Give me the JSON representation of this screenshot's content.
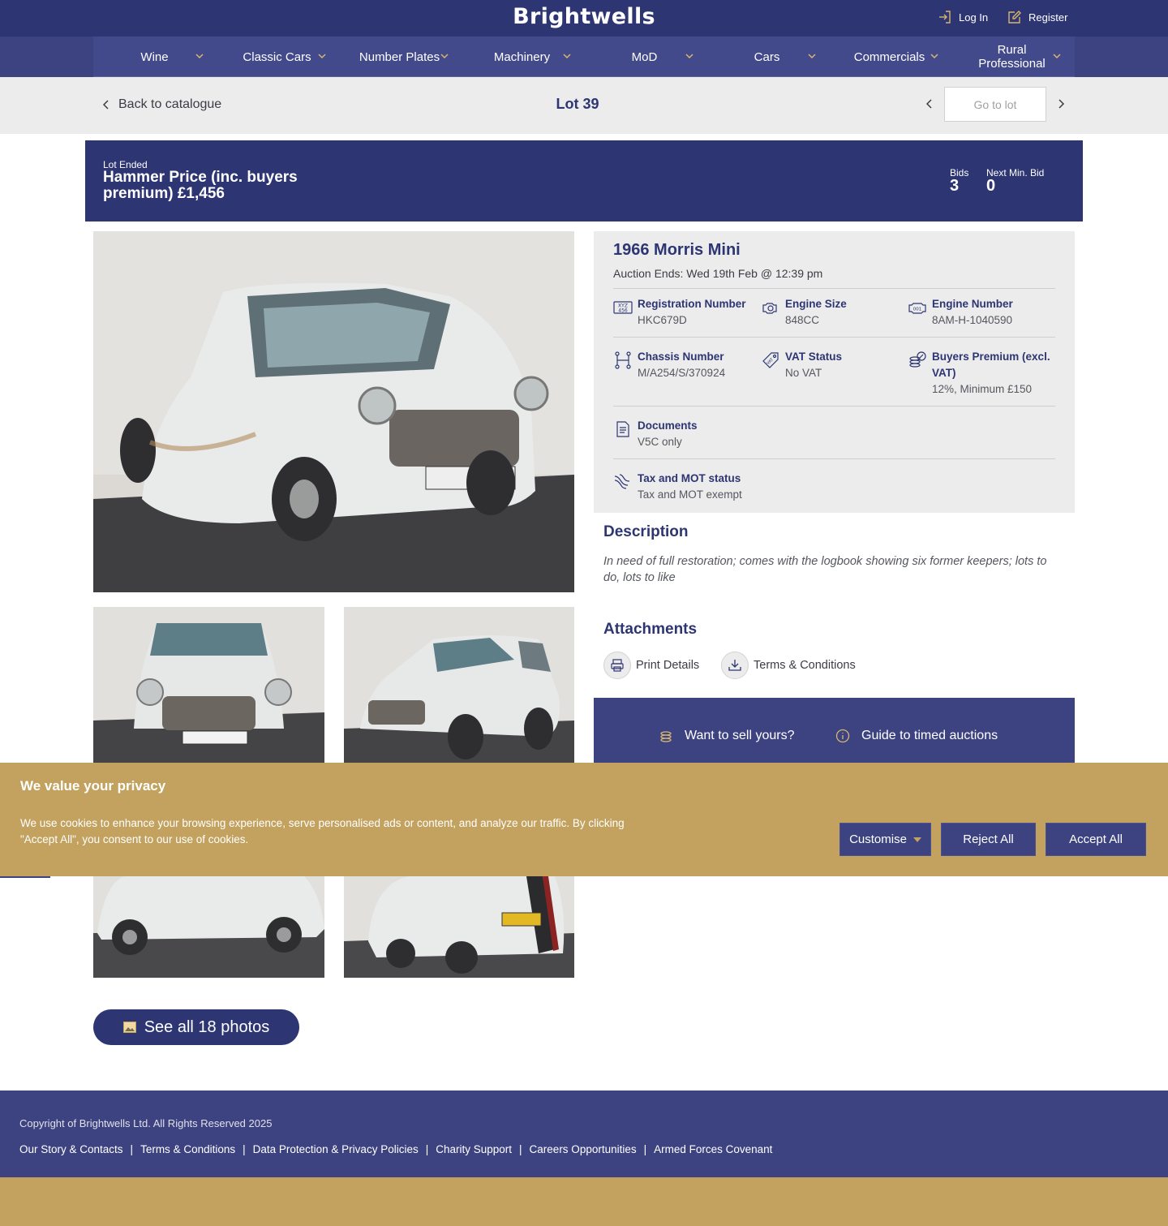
{
  "header": {
    "logo": "Brightwells",
    "login_label": "Log In",
    "register_label": "Register"
  },
  "nav": {
    "items": [
      {
        "label": "Wine"
      },
      {
        "label": "Classic Cars"
      },
      {
        "label": "Number Plates"
      },
      {
        "label": "Machinery"
      },
      {
        "label": "MoD"
      },
      {
        "label": "Cars"
      },
      {
        "label": "Commercials"
      },
      {
        "label": "Rural Professional"
      }
    ]
  },
  "lotbar": {
    "back_label": "Back to catalogue",
    "lot_title": "Lot 39",
    "goto_placeholder": "Go to lot"
  },
  "banner": {
    "status": "Lot Ended",
    "hammer_price": "Hammer Price (inc. buyers premium) £1,456",
    "bids_label": "Bids",
    "bids_value": "3",
    "next_min_bid_label": "Next Min. Bid",
    "next_min_bid_value": "0"
  },
  "gallery": {
    "see_all_label": "See all 18 photos"
  },
  "details": {
    "title": "1966 Morris Mini",
    "auction_ends": "Auction Ends: Wed 19th Feb @ 12:39 pm",
    "specs": [
      {
        "icon": "registration-plate-icon",
        "label": "Registration Number",
        "value": "HKC679D"
      },
      {
        "icon": "engine-size-icon",
        "label": "Engine Size",
        "value": "848CC"
      },
      {
        "icon": "engine-number-icon",
        "label": "Engine Number",
        "value": "8AM-H-1040590"
      },
      {
        "icon": "chassis-icon",
        "label": "Chassis Number",
        "value": "M/A254/S/370924"
      },
      {
        "icon": "vat-tag-icon",
        "label": "VAT Status",
        "value": "No VAT"
      },
      {
        "icon": "coins-percent-icon",
        "label": "Buyers Premium (excl. VAT)",
        "value": "12%, Minimum £150"
      },
      {
        "icon": "document-icon",
        "label": "Documents",
        "value": "V5C only"
      },
      {
        "icon": "wind-icon",
        "label": "Tax and MOT status",
        "value": "Tax and MOT exempt"
      }
    ]
  },
  "description": {
    "heading": "Description",
    "text": "In need of full restoration; comes with the logbook showing six former keepers; lots to do, lots to like"
  },
  "attachments": {
    "heading": "Attachments",
    "print_label": "Print Details",
    "terms_label": "Terms & Conditions"
  },
  "sell": {
    "want_to_sell": "Want to sell yours?",
    "guide": "Guide to timed auctions"
  },
  "cookie": {
    "title": "We value your privacy",
    "text": "We use cookies to enhance your browsing experience, serve personalised ads or content, and analyze our traffic. By clicking \"Accept All\", you consent to our use of cookies.",
    "customise": "Customise",
    "reject": "Reject All",
    "accept": "Accept All"
  },
  "footer": {
    "copyright": "Copyright of Brightwells Ltd. All Rights Reserved 2025",
    "links": [
      "Our Story & Contacts",
      "Terms & Conditions",
      "Data Protection & Privacy Policies",
      "Charity Support",
      "Careers Opportunities",
      "Armed Forces Covenant"
    ]
  },
  "colors": {
    "navy": "#2d3572",
    "nav_blue": "#3d4380",
    "gold": "#c3a25f",
    "panel_grey": "#ececec"
  }
}
